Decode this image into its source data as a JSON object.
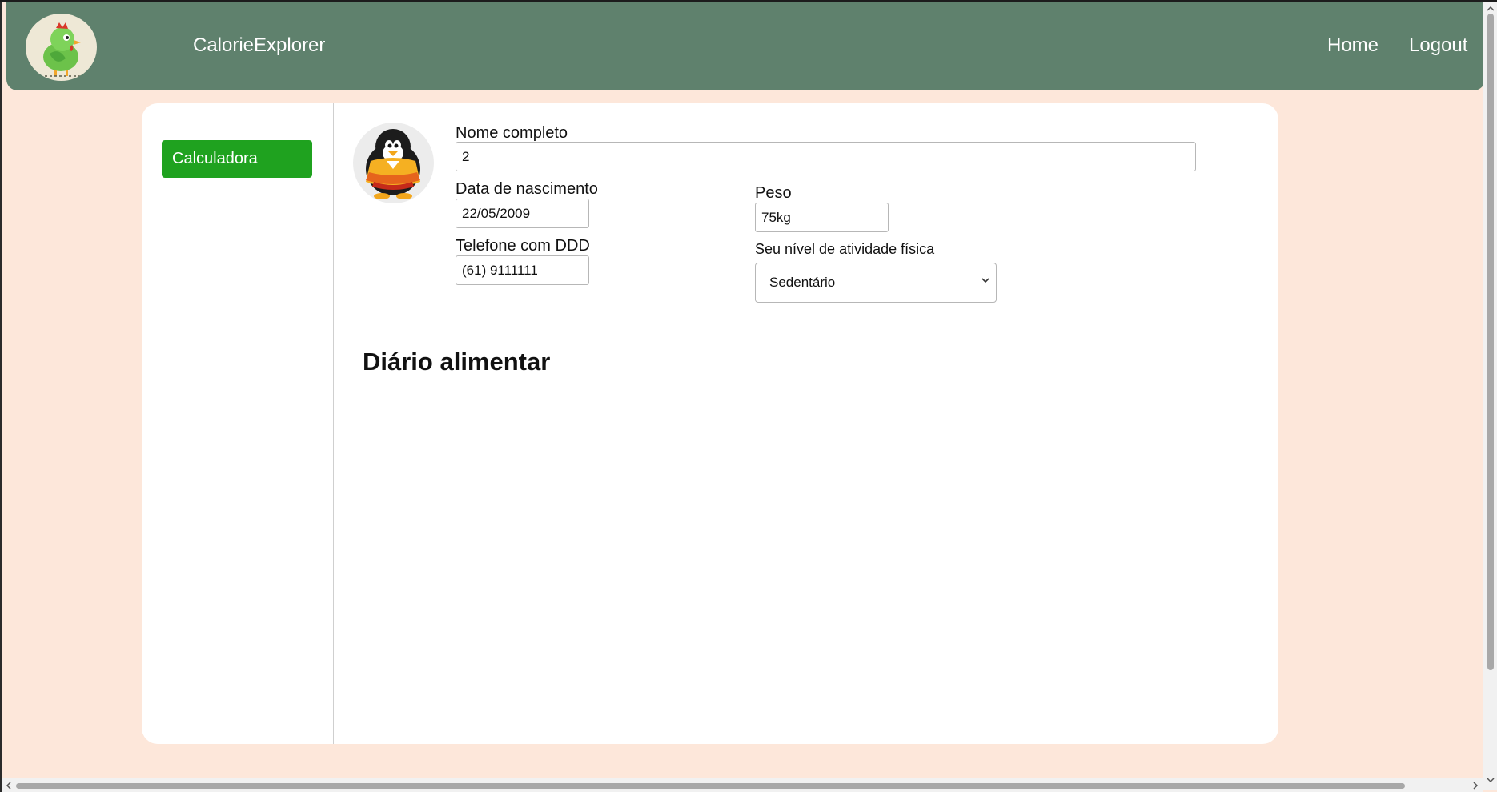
{
  "header": {
    "brand": "CalorieExplorer",
    "logo_icon": "chicken-logo-icon",
    "nav": [
      {
        "label": "Home"
      },
      {
        "label": "Logout"
      }
    ]
  },
  "sidebar": {
    "button_label": "Calculadora",
    "button_color": "#1fa21f"
  },
  "profile": {
    "avatar_icon": "penguin-avatar-icon",
    "full_name": {
      "label": "Nome completo",
      "value": "2"
    },
    "birth_date": {
      "label": "Data de nascimento",
      "value": "22/05/2009"
    },
    "phone": {
      "label": "Telefone com DDD",
      "value": "(61) 9111111"
    },
    "weight": {
      "label": "Peso",
      "value": "75kg"
    },
    "activity": {
      "label": "Seu nível de atividade física",
      "selected": "Sedentário"
    }
  },
  "diary": {
    "title": "Diário alimentar"
  },
  "colors": {
    "navbar": "#5f816d",
    "page_background": "#fde7da",
    "accent_green": "#1fa21f"
  }
}
